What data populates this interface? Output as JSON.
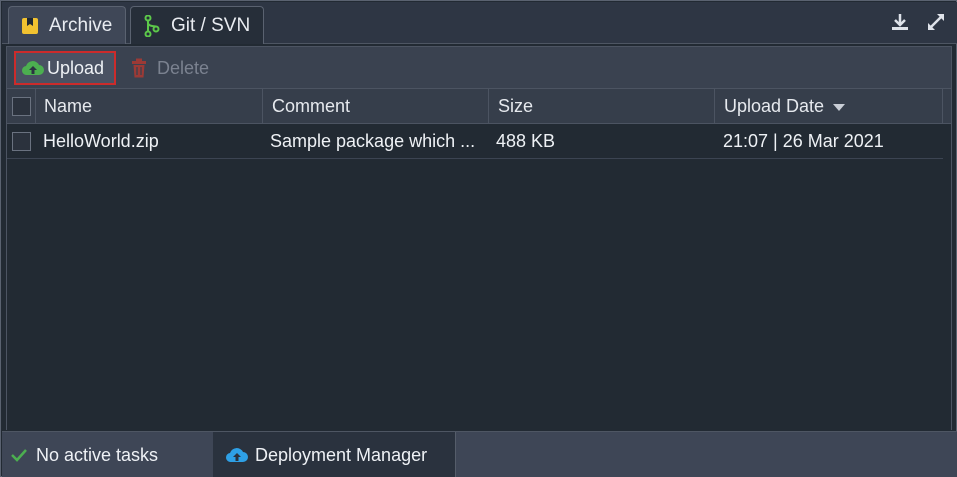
{
  "tabs": [
    {
      "label": "Archive",
      "icon": "archive-icon",
      "active": true
    },
    {
      "label": "Git / SVN",
      "icon": "git-branch-icon",
      "active": false
    }
  ],
  "tab_actions": [
    {
      "icon": "download-icon"
    },
    {
      "icon": "expand-icon"
    }
  ],
  "toolbar": {
    "upload_label": "Upload",
    "delete_label": "Delete"
  },
  "grid": {
    "columns": [
      "Name",
      "Comment",
      "Size",
      "Upload Date"
    ],
    "sort_column": "Upload Date",
    "sort_direction": "descending",
    "rows": [
      {
        "name": "HelloWorld.zip",
        "comment": "Sample package which ...",
        "size": "488 KB",
        "upload_date": "21:07 | 26 Mar 2021"
      }
    ]
  },
  "statusbar": {
    "tasks_label": "No active tasks",
    "manager_label": "Deployment Manager"
  },
  "colors": {
    "accent_red": "#cc2b2b",
    "upload_green": "#4caf50",
    "delete_red": "#9b3a36",
    "git_green": "#5cc84a",
    "cloud_blue": "#2ea0e6",
    "archive_yellow": "#f2c230"
  }
}
